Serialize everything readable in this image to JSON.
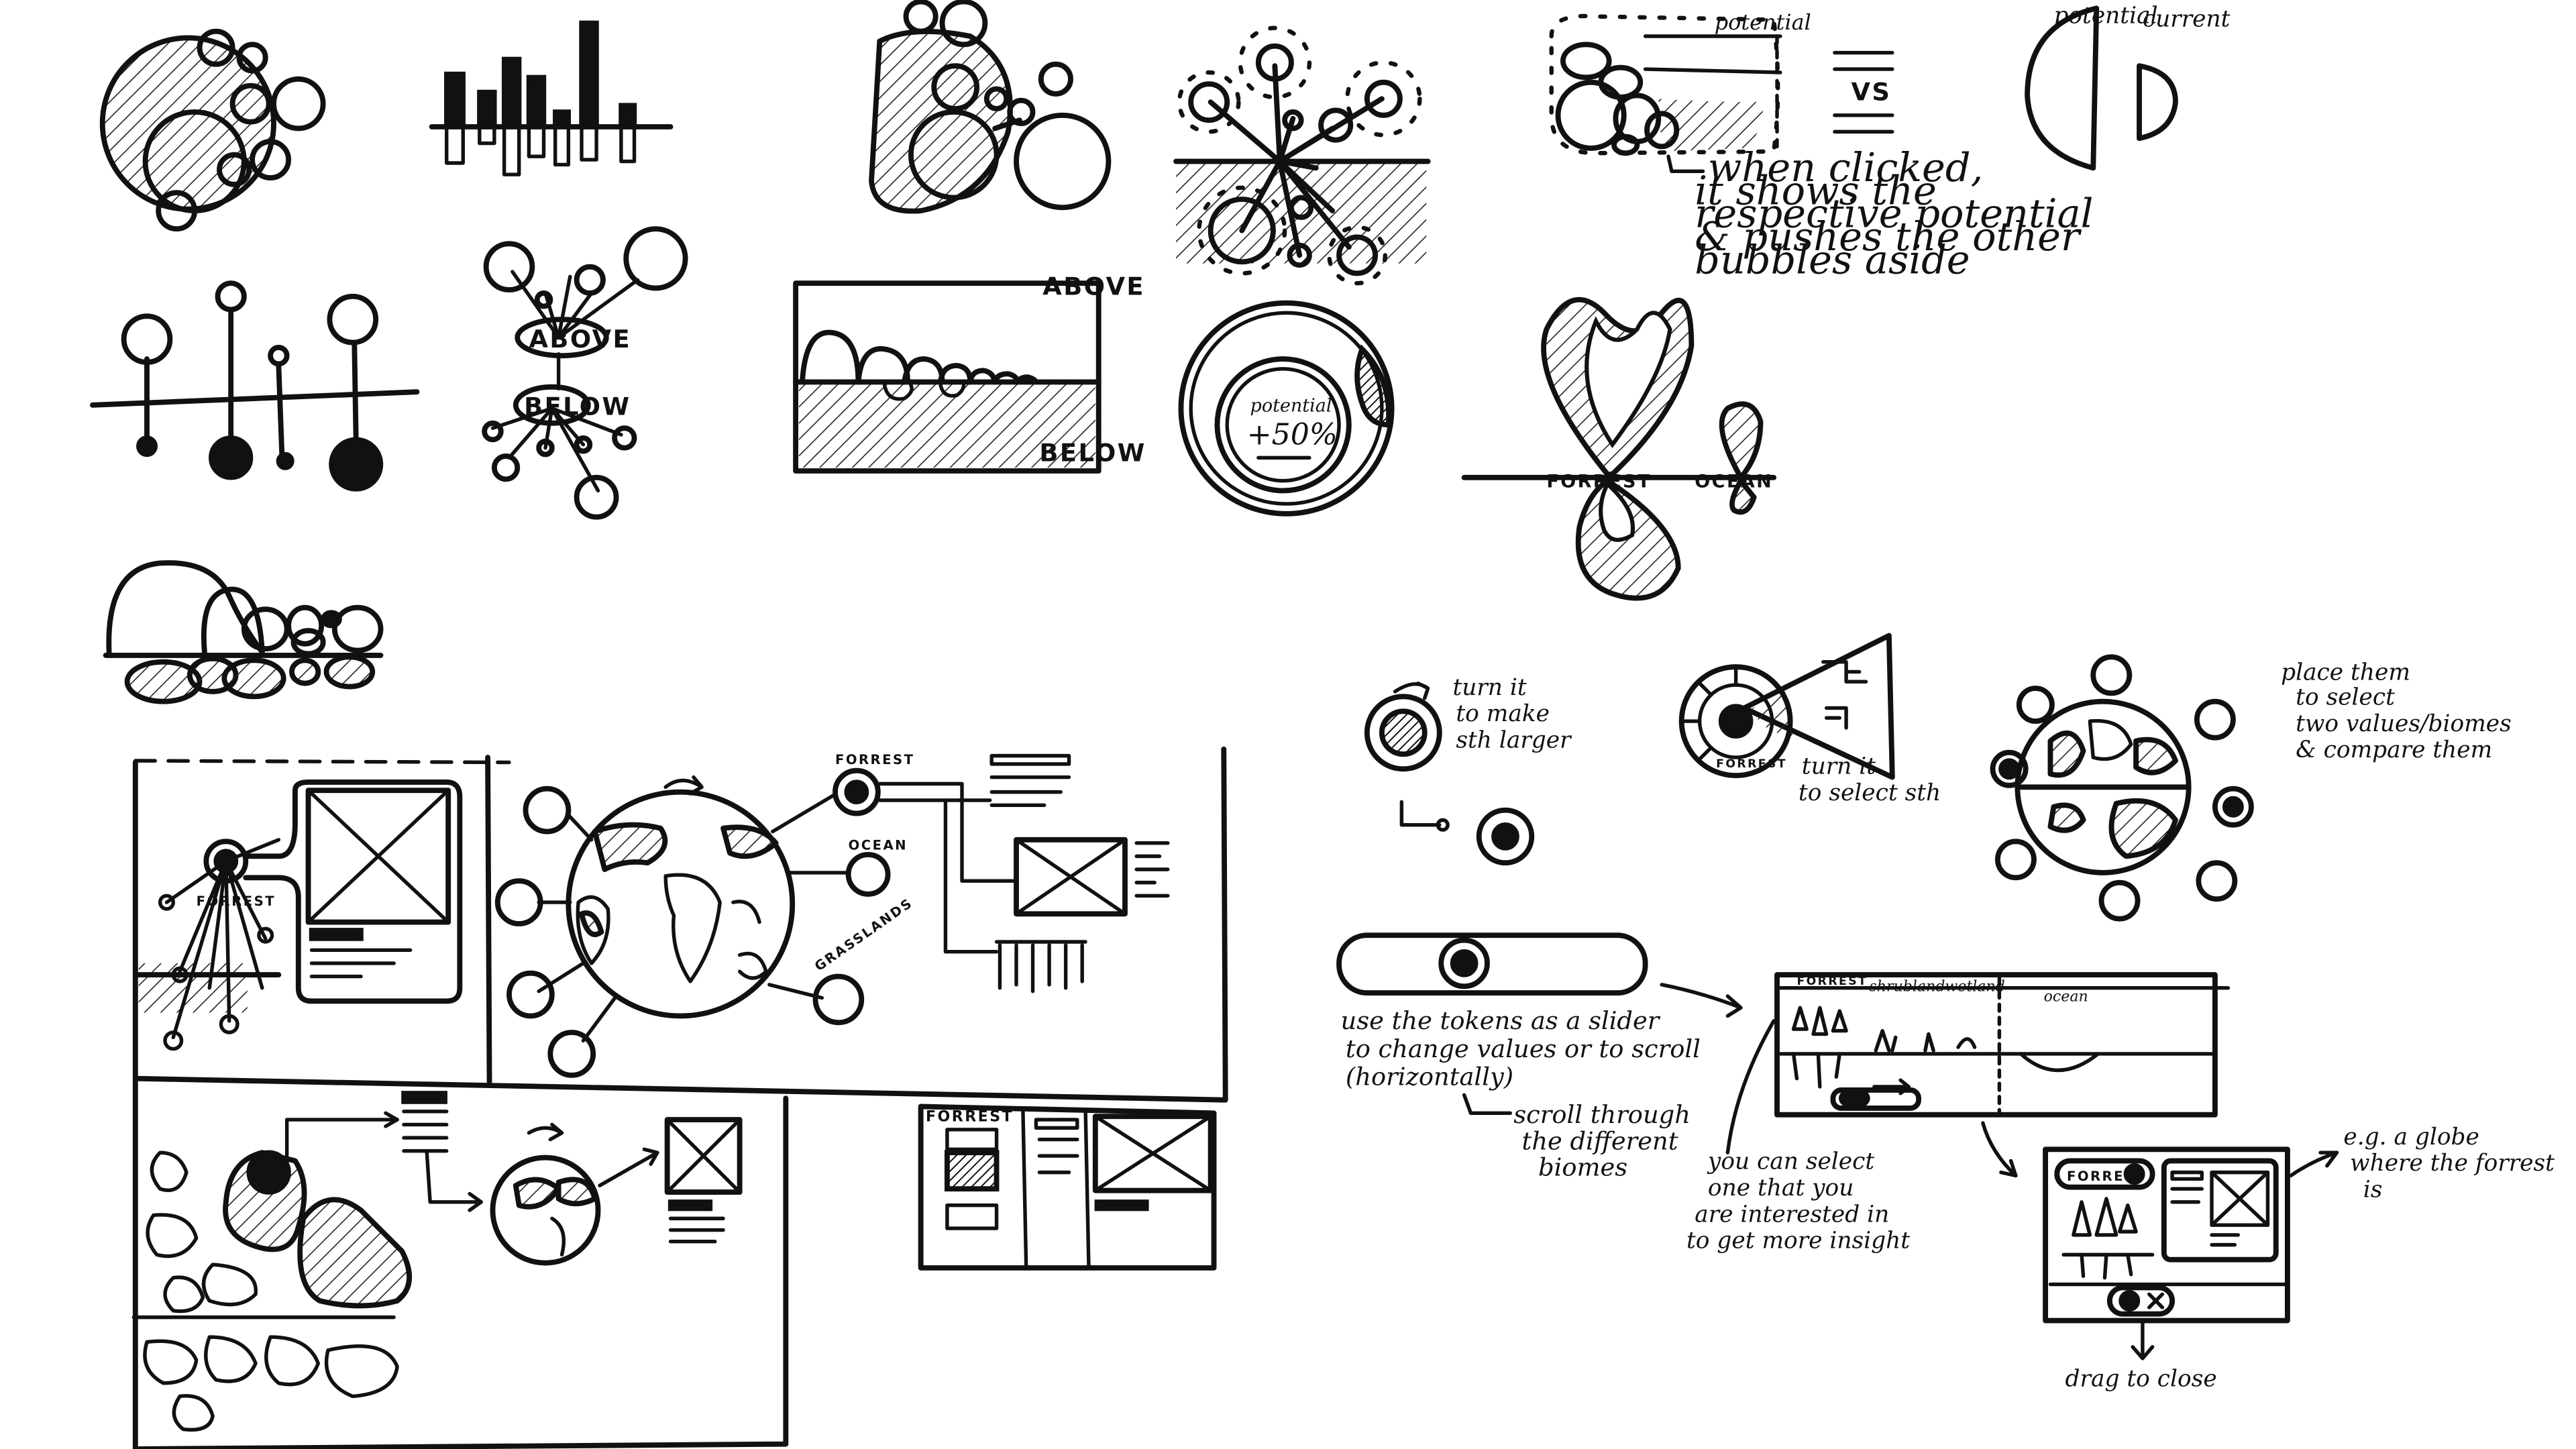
{
  "labels": {
    "potential": "potential",
    "current": "current",
    "vs": "VS",
    "above": "ABOVE",
    "below": "BELOW",
    "forrest": "FORREST",
    "ocean": "OCEAN",
    "grasslands": "GRASSLANDS",
    "shrubland": "shrubland",
    "wetland": "wetland",
    "ocean_lower": "ocean",
    "potential_small": "potential",
    "plus_50": "+50%",
    "forrest_token": "FORREST",
    "forrest_card": "FORREST"
  },
  "notes": {
    "when_clicked": [
      "when clicked,",
      "it shows the",
      "respective potential",
      "& pushes the other",
      "bubbles aside"
    ],
    "turn_it_larger": [
      "turn it",
      "to make",
      "sth larger"
    ],
    "turn_it_select": [
      "turn it",
      "to select sth"
    ],
    "place_them": [
      "place them",
      "to select",
      "two values/biomes",
      "& compare them"
    ],
    "use_tokens": [
      "use the tokens as a slider",
      "to change values or to scroll",
      "(horizontally)"
    ],
    "scroll_through": [
      "scroll through",
      "the different",
      "biomes"
    ],
    "you_can_select": [
      "you can select",
      "one that you",
      "are interested in",
      "to get more insight"
    ],
    "globe_note": [
      "e.g. a globe",
      "where the forrest",
      "is"
    ],
    "drag_to_close": "drag to close"
  }
}
